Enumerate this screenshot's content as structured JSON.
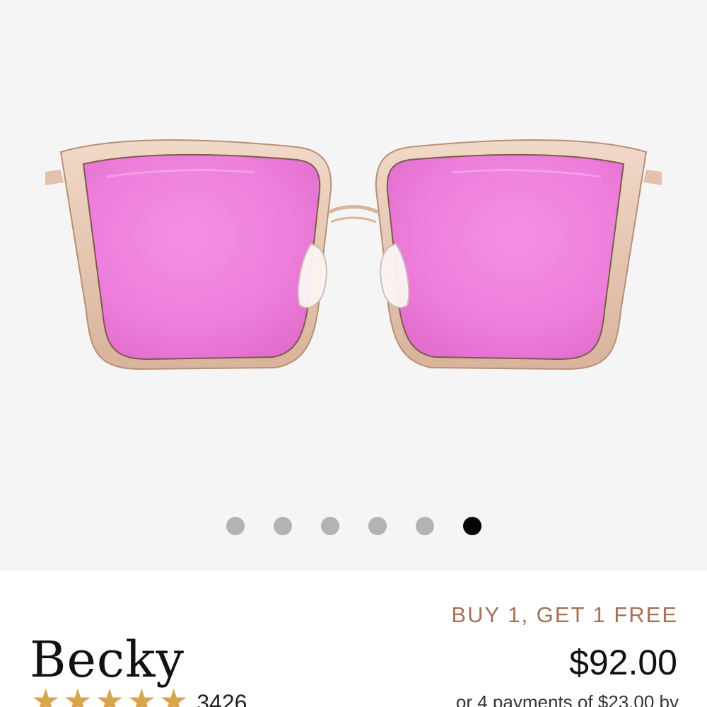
{
  "gallery": {
    "image_name": "pink mirrored cat-eye sunglasses",
    "slide_count": 6,
    "active_slide": 6,
    "colors": {
      "background": "#f5f5f5",
      "lens": "#ee7fdc",
      "frame": "#e7c9b3",
      "dot_inactive": "#b3b3b3",
      "dot_active": "#050505"
    }
  },
  "product": {
    "promo": "BUY 1, GET 1 FREE",
    "name": "Becky",
    "price": "$92.00",
    "rating_stars": 5,
    "review_count": "3426",
    "installments": "or 4 payments of $23.00 by"
  },
  "colors": {
    "promo": "#a5705a",
    "star": "#d9a44e"
  }
}
